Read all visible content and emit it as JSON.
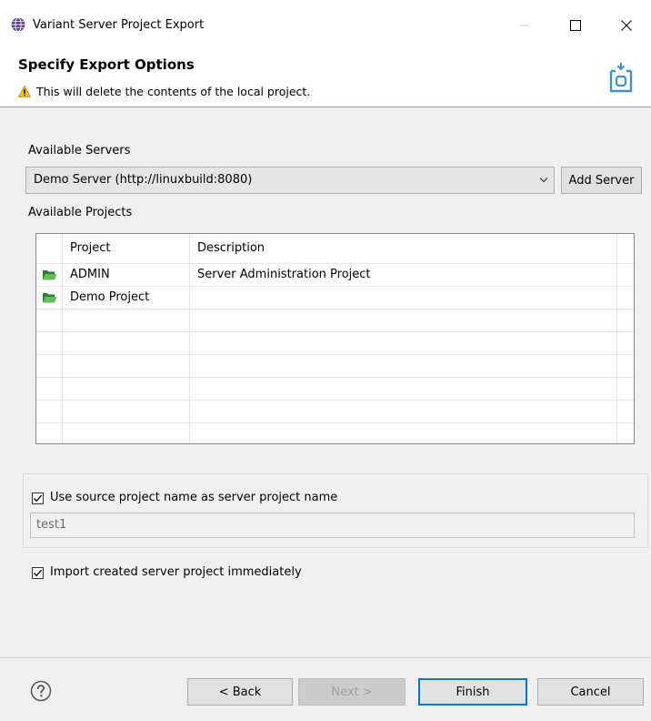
{
  "window": {
    "title": "Variant Server Project Export"
  },
  "banner": {
    "title": "Specify Export Options",
    "message": "This will delete the contents of the local project."
  },
  "servers": {
    "label": "Available Servers",
    "selected": "Demo Server (http://linuxbuild:8080)",
    "add_button": "Add Server"
  },
  "projects": {
    "label": "Available Projects",
    "columns": [
      "Project",
      "Description"
    ],
    "rows": [
      {
        "project": "ADMIN",
        "description": "Server Administration Project"
      },
      {
        "project": "Demo Project",
        "description": ""
      }
    ]
  },
  "options": {
    "use_source_name": {
      "label": "Use source project name as server project name",
      "checked": true
    },
    "server_project_name": "test1",
    "import_immediately": {
      "label": "Import created server project immediately",
      "checked": true
    }
  },
  "footer": {
    "back": "< Back",
    "next": "Next >",
    "finish": "Finish",
    "cancel": "Cancel"
  },
  "colors": {
    "accent": "#0078d7",
    "folder_green": "#3c9a3c",
    "warning": "#f2c12e"
  }
}
